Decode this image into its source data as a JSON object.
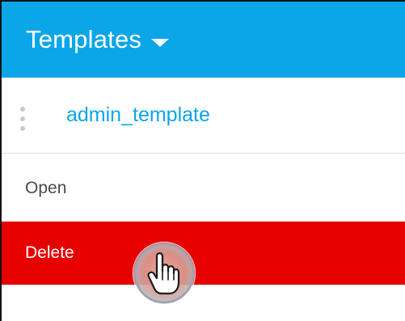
{
  "header": {
    "title": "Templates",
    "dropdown_icon": "caret-down-icon",
    "background": "#0aa6e8"
  },
  "template": {
    "name": "admin_template",
    "handle_icon": "drag-handle-icon",
    "color": "#0aa6e8"
  },
  "context_menu": {
    "items": [
      {
        "label": "Open",
        "highlighted": false
      },
      {
        "label": "Delete",
        "highlighted": true,
        "highlight_color": "#e60000"
      }
    ]
  },
  "cursor": {
    "icon": "hand-pointer-icon"
  }
}
